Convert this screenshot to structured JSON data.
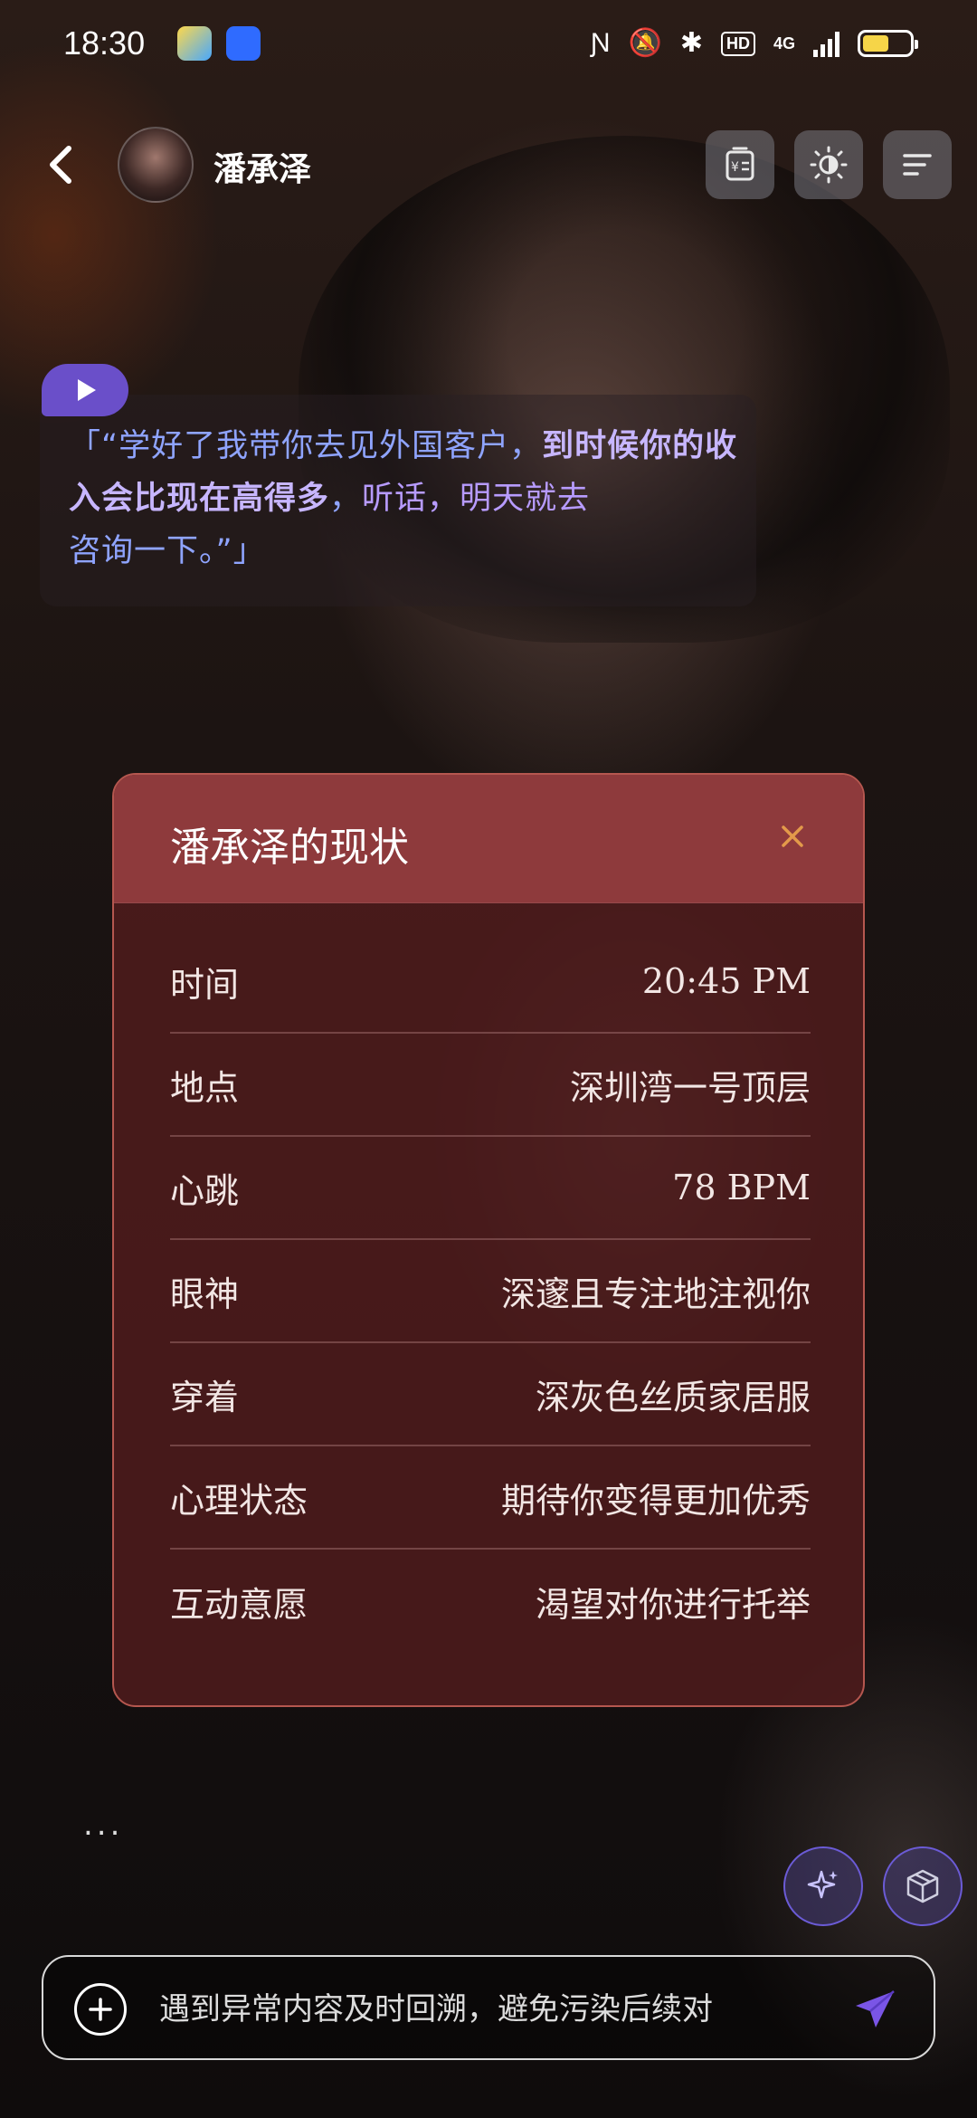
{
  "status_bar": {
    "time": "18:30",
    "network": "4G",
    "hd": "HD",
    "battery_level": 0.55
  },
  "header": {
    "character_name": "潘承泽",
    "buttons": [
      "wallet-icon",
      "theme-icon",
      "menu-icon"
    ]
  },
  "narration": {
    "open": "「“学好了我带你去见外国客户，",
    "bold": "到时候你的收入会比现在高得多",
    "mid": "，",
    "purple": "听话，明天就去",
    "close": "咨询一下。”」"
  },
  "status_card": {
    "title": "潘承泽的现状",
    "rows": [
      {
        "label": "时间",
        "value": "20:45 PM"
      },
      {
        "label": "地点",
        "value": "深圳湾一号顶层"
      },
      {
        "label": "心跳",
        "value": "78 BPM"
      },
      {
        "label": "眼神",
        "value": "深邃且专注地注视你"
      },
      {
        "label": "穿着",
        "value": "深灰色丝质家居服"
      },
      {
        "label": "心理状态",
        "value": "期待你变得更加优秀"
      },
      {
        "label": "互动意愿",
        "value": "渴望对你进行托举"
      }
    ]
  },
  "typing_indicator": "...",
  "input": {
    "placeholder": "遇到异常内容及时回溯，避免污染后续对"
  },
  "colors": {
    "accent": "#6a4fc9",
    "card_header": "#8e3a3c",
    "narration_blue": "#8fa4ff",
    "narration_purple": "#b79bff"
  }
}
